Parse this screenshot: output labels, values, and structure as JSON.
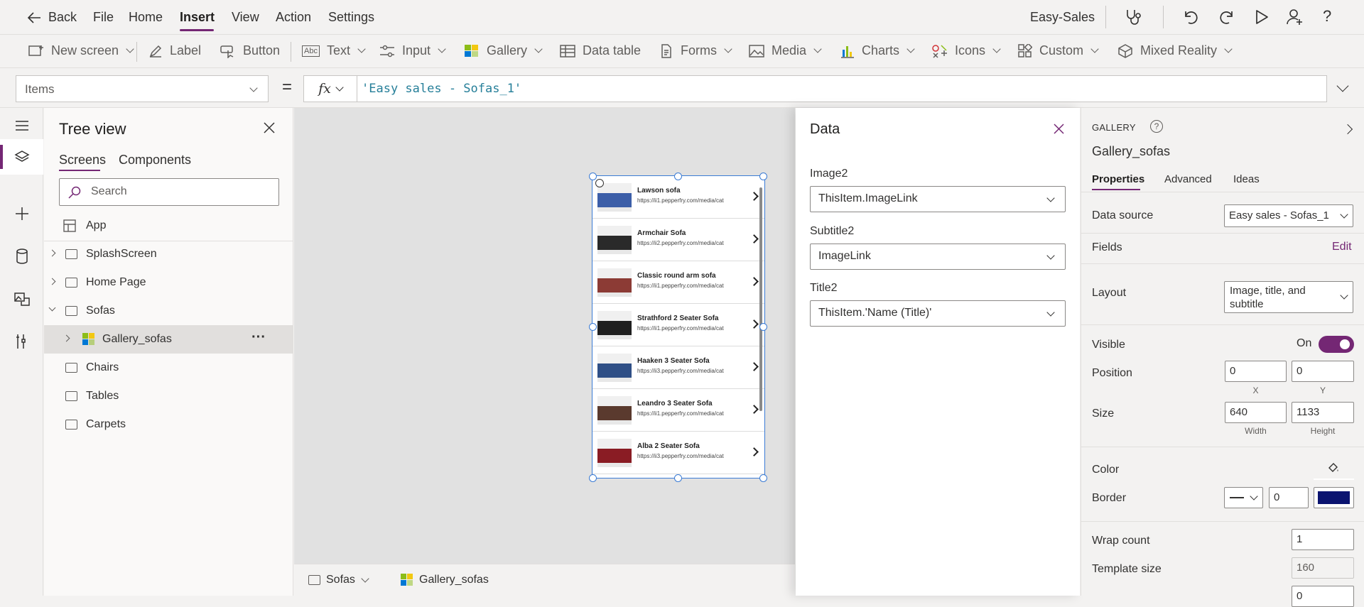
{
  "menubar": {
    "back_label": "Back",
    "items": [
      "File",
      "Home",
      "Insert",
      "View",
      "Action",
      "Settings"
    ],
    "active_item": "Insert",
    "app_name": "Easy-Sales"
  },
  "toolbar": {
    "items": [
      "New screen",
      "Label",
      "Button",
      "Text",
      "Input",
      "Gallery",
      "Data table",
      "Forms",
      "Media",
      "Charts",
      "Icons",
      "Custom",
      "Mixed Reality"
    ]
  },
  "formula_bar": {
    "property": "Items",
    "equals": "=",
    "fx": "fx",
    "formula": "'Easy sales - Sofas_1'"
  },
  "tree_view": {
    "title": "Tree view",
    "tabs": [
      "Screens",
      "Components"
    ],
    "active_tab": "Screens",
    "search_placeholder": "Search",
    "items": [
      {
        "label": "App"
      },
      {
        "label": "SplashScreen"
      },
      {
        "label": "Home Page"
      },
      {
        "label": "Sofas"
      },
      {
        "label": "Gallery_sofas"
      },
      {
        "label": "Chairs"
      },
      {
        "label": "Tables"
      },
      {
        "label": "Carpets"
      }
    ],
    "more_glyph": "···"
  },
  "gallery": {
    "items": [
      {
        "title": "Lawson sofa",
        "subtitle": "https://ii1.pepperfry.com/media/cat",
        "color": "#3c5ea8"
      },
      {
        "title": "Armchair Sofa",
        "subtitle": "https://ii2.pepperfry.com/media/cat",
        "color": "#2a2a2a"
      },
      {
        "title": "Classic round arm sofa",
        "subtitle": "https://ii1.pepperfry.com/media/cat",
        "color": "#8c3b35"
      },
      {
        "title": "Strathford 2 Seater Sofa",
        "subtitle": "https://ii1.pepperfry.com/media/cat",
        "color": "#1f1f1f"
      },
      {
        "title": "Haaken 3 Seater Sofa",
        "subtitle": "https://ii3.pepperfry.com/media/cat",
        "color": "#2f4f86"
      },
      {
        "title": "Leandro 3 Seater Sofa",
        "subtitle": "https://ii1.pepperfry.com/media/cat",
        "color": "#5a3a2e"
      },
      {
        "title": "Alba 2 Seater Sofa",
        "subtitle": "https://ii3.pepperfry.com/media/cat",
        "color": "#8a1c24"
      }
    ]
  },
  "bottom_bar": {
    "screen": "Sofas",
    "control": "Gallery_sofas"
  },
  "data_panel": {
    "title": "Data",
    "fields": [
      {
        "label": "Image2",
        "value": "ThisItem.ImageLink"
      },
      {
        "label": "Subtitle2",
        "value": "ImageLink"
      },
      {
        "label": "Title2",
        "value": "ThisItem.'Name (Title)'"
      }
    ]
  },
  "properties": {
    "type_label": "GALLERY",
    "control_name": "Gallery_sofas",
    "tabs": [
      "Properties",
      "Advanced",
      "Ideas"
    ],
    "active_tab": "Properties",
    "data_source_label": "Data source",
    "data_source_value": "Easy sales - Sofas_1",
    "fields_label": "Fields",
    "fields_edit": "Edit",
    "layout_label": "Layout",
    "layout_value": "Image, title, and subtitle",
    "visible_label": "Visible",
    "visible_value": "On",
    "position_label": "Position",
    "position_x": "0",
    "position_y": "0",
    "x_cap": "X",
    "y_cap": "Y",
    "size_label": "Size",
    "size_width": "640",
    "size_height": "1133",
    "width_cap": "Width",
    "height_cap": "Height",
    "color_label": "Color",
    "border_label": "Border",
    "border_width": "0",
    "border_color": "#0b1470",
    "wrap_count_label": "Wrap count",
    "wrap_count_value": "1",
    "template_size_label": "Template size",
    "template_size_value": "160",
    "template_padding_value": "0"
  },
  "colors": {
    "accent": "#742774",
    "selection": "#3a7bd5"
  }
}
